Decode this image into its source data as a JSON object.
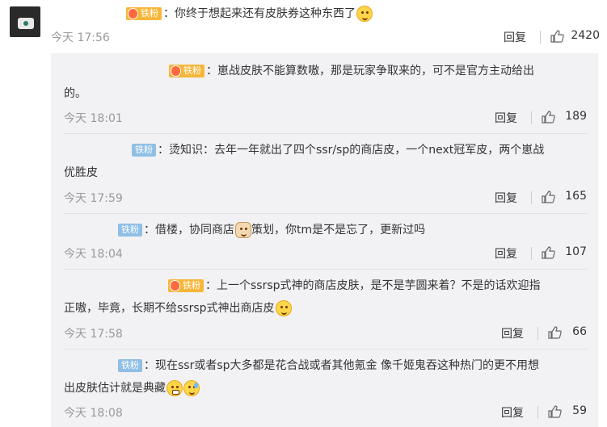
{
  "main_comment": {
    "badge": "铁粉",
    "text": "：你终于想起来还有皮肤券这种东西了",
    "emoji": "thinking-emoji",
    "time": "今天 17:56",
    "reply_label": "回复",
    "likes": "2420"
  },
  "replies": [
    {
      "badge": "铁粉",
      "text": "：崽战皮肤不能算数嗷，那是玩家争取来的，可不是官方主动给出",
      "text2": "的。",
      "time": "今天 18:01",
      "reply_label": "回复",
      "likes": "189"
    },
    {
      "badge": "铁粉",
      "text": "：烫知识：去年一年就出了四个ssr/sp的商店皮，一个next冠军皮，两个崽战",
      "text2": "优胜皮",
      "time": "今天 17:59",
      "reply_label": "回复",
      "likes": "165"
    },
    {
      "badge": "铁粉",
      "text_a": "：借楼，协同商店",
      "text_b": "策划，你tm是不是忘了，更新过吗",
      "time": "今天 18:04",
      "reply_label": "回复",
      "likes": "107"
    },
    {
      "badge": "铁粉",
      "text": "：上一个ssrsp式神的商店皮肤，是不是芋圆来着？不是的话欢迎指",
      "text2": "正嗷，毕竟，长期不给ssrsp式神出商店皮",
      "time": "今天 17:58",
      "reply_label": "回复",
      "likes": "66"
    },
    {
      "badge": "铁粉",
      "text": "：现在ssr或者sp大多都是花合战或者其他氪金 像千姬鬼吞这种热门的更不用想",
      "text2": "出皮肤估计就是典藏",
      "time": "今天 18:08",
      "reply_label": "回复",
      "likes": "59"
    }
  ],
  "colors": {
    "gold_badge": "#f6b63a",
    "blue_badge": "#8fbfe4",
    "sub_background": "#f2f2f5",
    "meta_text": "#999999"
  }
}
